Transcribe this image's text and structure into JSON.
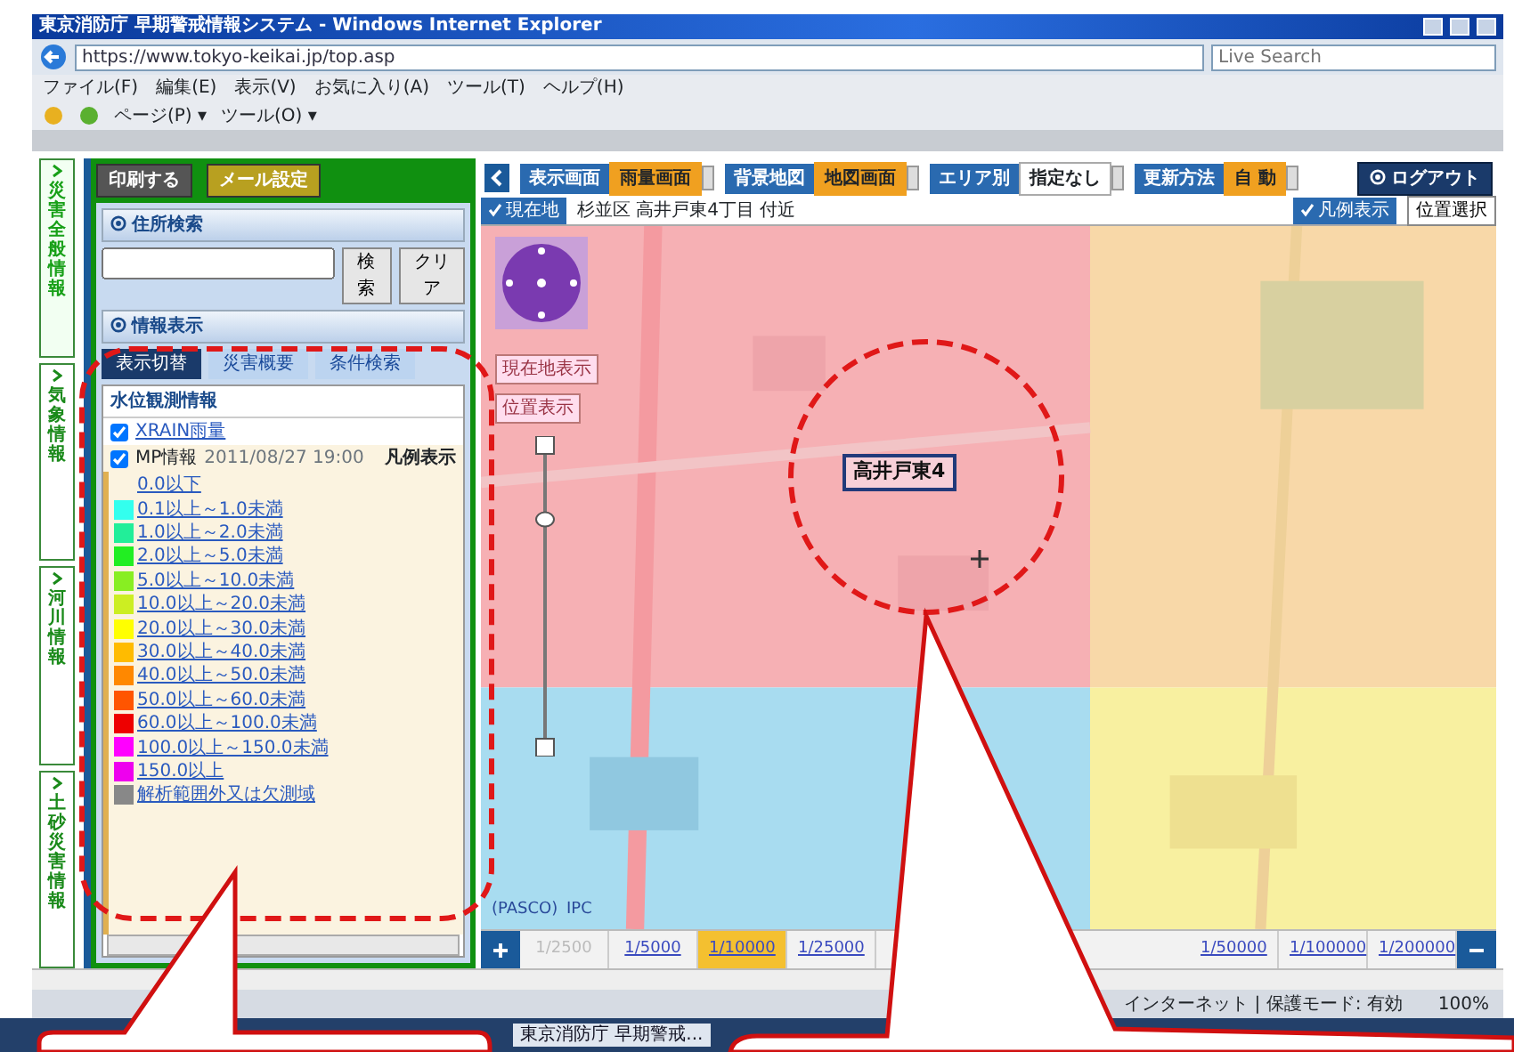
{
  "window": {
    "title": "東京消防庁 早期警戒情報システム - Windows Internet Explorer"
  },
  "browser": {
    "address": "https://www.tokyo-keikai.jp/top.asp",
    "search_placeholder": "Live Search",
    "menu": [
      "ファイル(F)",
      "編集(E)",
      "表示(V)",
      "お気に入り(A)",
      "ツール(T)",
      "ヘルプ(H)"
    ],
    "commands": [
      "ページ(P) ▾",
      "ツール(O) ▾"
    ]
  },
  "side_tabs": [
    {
      "label": "災害全般情報",
      "selected": true
    },
    {
      "label": "気象情報",
      "selected": false
    },
    {
      "label": "河川情報",
      "selected": false
    },
    {
      "label": "土砂災害情報",
      "selected": false
    }
  ],
  "panel": {
    "top_buttons": [
      {
        "label": "印刷する",
        "kind": "gray"
      },
      {
        "label": "メール設定",
        "kind": "gold"
      }
    ],
    "search": {
      "title": "住所検索",
      "buttons": [
        "検索",
        "クリア"
      ]
    },
    "info": {
      "title": "情報表示",
      "tabs": [
        {
          "label": "表示切替",
          "selected": true
        },
        {
          "label": "災害概要",
          "selected": false
        },
        {
          "label": "条件検索",
          "selected": false
        }
      ],
      "header": "水位観測情報",
      "layers": [
        {
          "label": "XRAIN雨量",
          "checked": true
        },
        {
          "label": "MP情報",
          "time": "2011/08/27 19:00",
          "action": "凡例表示",
          "checked": true
        }
      ],
      "legend": [
        {
          "label": "0.0以下"
        },
        {
          "label": "0.1以上～1.0未満",
          "color": "#33ffee"
        },
        {
          "label": "1.0以上～2.0未満",
          "color": "#22ee99"
        },
        {
          "label": "2.0以上～5.0未満",
          "color": "#22ee22"
        },
        {
          "label": "5.0以上～10.0未満",
          "color": "#88ee22"
        },
        {
          "label": "10.0以上～20.0未満",
          "color": "#ccee22"
        },
        {
          "label": "20.0以上～30.0未満",
          "color": "#ffff00"
        },
        {
          "label": "30.0以上～40.0未満",
          "color": "#ffbb00"
        },
        {
          "label": "40.0以上～50.0未満",
          "color": "#ff8800"
        },
        {
          "label": "50.0以上～60.0未満",
          "color": "#ff5500"
        },
        {
          "label": "60.0以上～100.0未満",
          "color": "#ee0000"
        },
        {
          "label": "100.0以上～150.0未満",
          "color": "#ff00ff"
        },
        {
          "label": "150.0以上",
          "color": "#ee00ee"
        },
        {
          "label": "解析範囲外又は欠測域",
          "color": "#888888"
        }
      ]
    }
  },
  "map": {
    "toolbar": [
      {
        "label": "表示画面",
        "value": "雨量画面",
        "highlight": true
      },
      {
        "label": "背景地図",
        "value": "地図画面",
        "highlight": true
      },
      {
        "label": "エリア別",
        "value": "指定なし",
        "highlight": false
      },
      {
        "label": "更新方法",
        "value": "自 動",
        "highlight": true
      }
    ],
    "logout": "ログアウト",
    "location_button": "現在地",
    "location": "杉並区 高井戸東4丁目 付近",
    "legend_button": "凡例表示",
    "select_button": "位置選択",
    "side_buttons": [
      "現在地表示",
      "位置表示"
    ],
    "zoom": {
      "level": 0.77
    },
    "place_label": "高井戸東4",
    "credits": [
      "(PASCO)",
      "IPC"
    ],
    "scales": [
      {
        "label": "1/2500",
        "selected": false,
        "disabled": true
      },
      {
        "label": "1/5000",
        "selected": false,
        "disabled": false
      },
      {
        "label": "1/10000",
        "selected": true,
        "disabled": false
      },
      {
        "label": "1/25000",
        "selected": false,
        "disabled": false
      },
      {
        "label": "1/50000",
        "selected": false,
        "disabled": false
      },
      {
        "label": "1/100000",
        "selected": false,
        "disabled": false
      },
      {
        "label": "1/200000",
        "selected": false,
        "disabled": false
      }
    ]
  },
  "status": {
    "zone": "インターネット | 保護モード: 有効",
    "zoom": "100%"
  },
  "taskbar": {
    "item": "東京消防庁 早期警戒..."
  }
}
